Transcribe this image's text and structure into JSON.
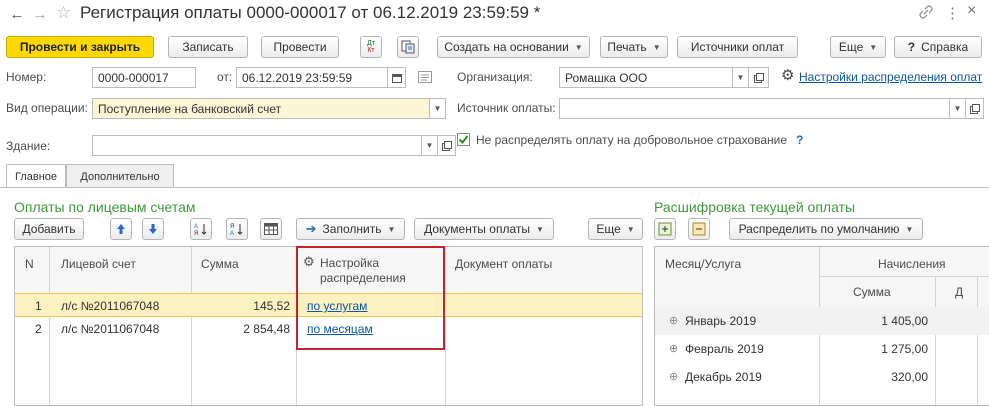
{
  "window": {
    "title": "Регистрация оплаты 0000-000017 от 06.12.2019 23:59:59 *",
    "back_glyph": "←",
    "forward_glyph": "→",
    "star_glyph": "☆",
    "link_glyph": "🔗",
    "more_glyph": "⋮",
    "close_glyph": "×"
  },
  "toolbar": {
    "post_close": "Провести и закрыть",
    "save": "Записать",
    "post": "Провести",
    "dt_kt_top": "Дт",
    "dt_kt_bottom": "Кт",
    "create_based": "Создать на основании",
    "print": "Печать",
    "sources": "Источники оплат",
    "more": "Еще",
    "help_q": "?",
    "help": "Справка"
  },
  "form": {
    "number_label": "Номер:",
    "number_value": "0000-000017",
    "from_label": "от:",
    "date_value": "06.12.2019 23:59:59",
    "org_label": "Организация:",
    "org_value": "Ромашка ООО",
    "settings_link": "Настройки распределения оплат",
    "optype_label": "Вид операции:",
    "optype_value": "Поступление на банковский счет",
    "source_label": "Источник оплаты:",
    "source_value": "",
    "building_label": "Здание:",
    "building_value": "",
    "no_distribute_label": "Не распределять оплату на добровольное страхование",
    "no_distribute_help": "?",
    "no_distribute_checked": true
  },
  "tabs": [
    "Главное",
    "Дополнительно"
  ],
  "left": {
    "section_title": "Оплаты по лицевым счетам",
    "add": "Добавить",
    "fill": "Заполнить",
    "payment_docs": "Документы оплаты",
    "more": "Еще",
    "columns": {
      "n": "N",
      "account": "Лицевой счет",
      "sum": "Сумма",
      "setting_line1": "Настройка",
      "setting_line2": "распределения",
      "doc": "Документ оплаты"
    },
    "rows": [
      {
        "n": "1",
        "account": "л/с №2011067048",
        "sum": "145,52",
        "setting": "по услугам"
      },
      {
        "n": "2",
        "account": "л/с №2011067048",
        "sum": "2 854,48",
        "setting": "по месяцам"
      }
    ]
  },
  "right": {
    "section_title": "Расшифровка текущей оплаты",
    "distribute_default": "Распределить по умолчанию",
    "columns": {
      "month_service": "Месяц/Услуга",
      "accruals": "Начисления",
      "sum": "Сумма",
      "cut": "Д"
    },
    "rows": [
      {
        "month": "Январь 2019",
        "sum": "1 405,00"
      },
      {
        "month": "Февраль 2019",
        "sum": "1 275,00"
      },
      {
        "month": "Декабрь 2019",
        "sum": "320,00"
      }
    ]
  },
  "colors": {
    "accent_yellow": "#ffd800",
    "row_highlight": "#fdf1c0",
    "section_green": "#3e9a3c",
    "link_blue": "#0b57a8",
    "callout_red": "#c0272d"
  }
}
